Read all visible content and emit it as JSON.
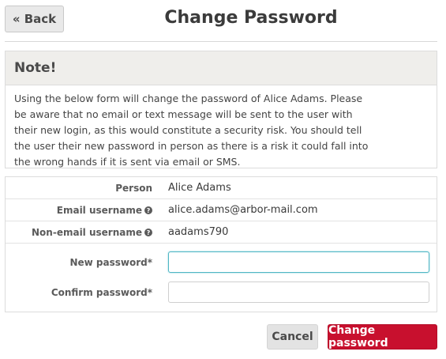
{
  "header": {
    "back_label": "« Back",
    "title": "Change Password"
  },
  "note": {
    "heading": "Note!",
    "body": "Using the below form will change the password of Alice Adams. Please be aware that no email or text message will be sent to the user with their new login, as this would constitute a security risk. You should tell the user their new password in person as there is a risk it could fall into the wrong hands if it is sent via email or SMS."
  },
  "form": {
    "person_label": "Person",
    "person_value": "Alice Adams",
    "email_username_label": "Email username",
    "email_username_value": "alice.adams@arbor-mail.com",
    "non_email_username_label": "Non-email username",
    "non_email_username_value": "aadams790",
    "new_password_label": "New password*",
    "new_password_value": "",
    "confirm_password_label": "Confirm password*",
    "confirm_password_value": "",
    "help_glyph": "?"
  },
  "actions": {
    "cancel_label": "Cancel",
    "submit_label": "Change password"
  },
  "colors": {
    "primary": "#c8102e",
    "focus": "#4fb6c4",
    "note_header_bg": "#efeeeb"
  }
}
